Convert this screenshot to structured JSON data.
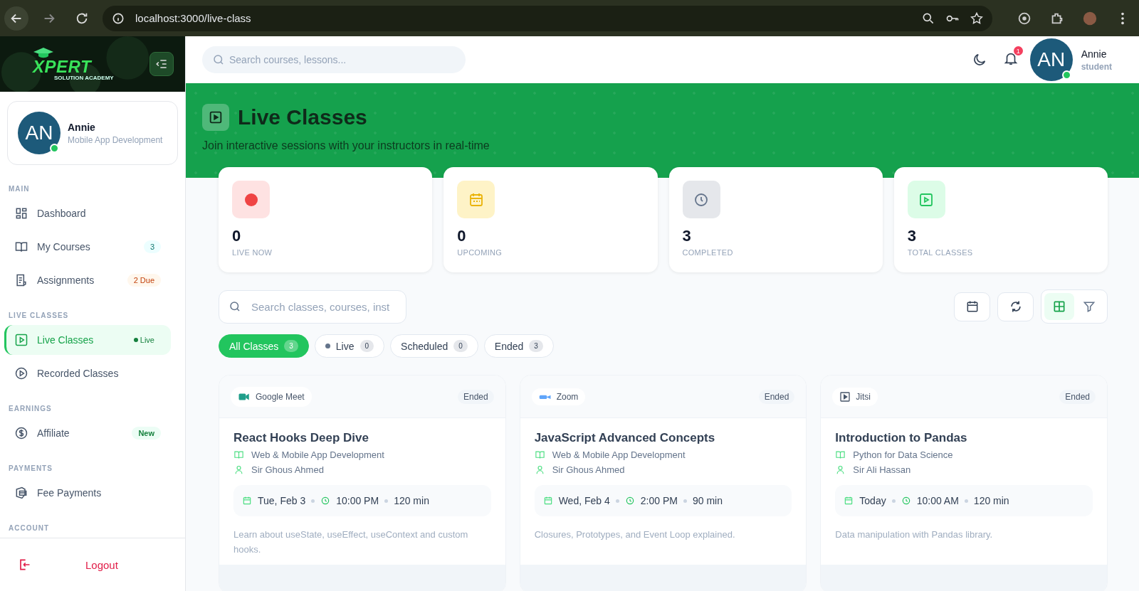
{
  "browser": {
    "url": "localhost:3000/live-class"
  },
  "sidebar": {
    "logo": {
      "title": "XPERT",
      "subtitle": "SOLUTION ACADEMY"
    },
    "profile": {
      "initials": "AN",
      "name": "Annie",
      "program": "Mobile App Development",
      "online": true
    },
    "sections": [
      {
        "title": "MAIN",
        "items": [
          {
            "label": "Dashboard",
            "selected": false
          },
          {
            "label": "My Courses",
            "badge": {
              "label": "3",
              "kind": "count"
            },
            "selected": false
          },
          {
            "label": "Assignments",
            "badge": {
              "label": "2 Due",
              "kind": "due"
            },
            "selected": false
          }
        ]
      },
      {
        "title": "LIVE CLASSES",
        "items": [
          {
            "label": "Live Classes",
            "badge": {
              "label": "Live",
              "kind": "live"
            },
            "selected": true
          },
          {
            "label": "Recorded Classes",
            "selected": false
          }
        ]
      },
      {
        "title": "EARNINGS",
        "items": [
          {
            "label": "Affiliate",
            "badge": {
              "label": "New",
              "kind": "new"
            },
            "selected": false
          }
        ]
      },
      {
        "title": "PAYMENTS",
        "items": [
          {
            "label": "Fee Payments",
            "selected": false
          }
        ]
      },
      {
        "title": "ACCOUNT"
      }
    ],
    "logout": "Logout"
  },
  "header": {
    "search": {
      "placeholder": "Search courses, lessons..."
    },
    "notifications": "1",
    "user": {
      "initials": "AN",
      "name": "Annie",
      "role": "student",
      "online": true
    }
  },
  "banner": {
    "title": "Live Classes",
    "subtitle": "Join interactive sessions with your instructors in real-time"
  },
  "stats": [
    {
      "kind": "live",
      "value": "0",
      "label": "LIVE NOW"
    },
    {
      "kind": "upcoming",
      "value": "0",
      "label": "UPCOMING"
    },
    {
      "kind": "completed",
      "value": "3",
      "label": "COMPLETED"
    },
    {
      "kind": "total",
      "value": "3",
      "label": "TOTAL CLASSES"
    }
  ],
  "search": {
    "placeholder": "Search classes, courses, inst"
  },
  "view_buttons": [
    {
      "kind": "grid",
      "selected": true
    },
    {
      "kind": "filter",
      "selected": false
    }
  ],
  "filters": [
    {
      "label": "All Classes",
      "count": "3",
      "kind": "all",
      "selected": true
    },
    {
      "label": "Live",
      "count": "0",
      "kind": "live",
      "selected": false
    },
    {
      "label": "Scheduled",
      "count": "0",
      "kind": "scheduled",
      "selected": false
    },
    {
      "label": "Ended",
      "count": "3",
      "kind": "ended",
      "selected": false
    }
  ],
  "classes": [
    {
      "platform": "Google Meet",
      "kind": "meet",
      "status": "Ended",
      "title": "React Hooks Deep Dive",
      "course": "Web & Mobile App Development",
      "instructor": "Sir Ghous Ahmed",
      "date": "Tue, Feb 3",
      "time": "10:00 PM",
      "duration": "120 min",
      "description": "Learn about useState, useEffect, useContext and custom hooks."
    },
    {
      "platform": "Zoom",
      "kind": "zoom",
      "status": "Ended",
      "title": "JavaScript Advanced Concepts",
      "course": "Web & Mobile App Development",
      "instructor": "Sir Ghous Ahmed",
      "date": "Wed, Feb 4",
      "time": "2:00 PM",
      "duration": "90 min",
      "description": "Closures, Prototypes, and Event Loop explained."
    },
    {
      "platform": "Jitsi",
      "kind": "jitsi",
      "status": "Ended",
      "title": "Introduction to Pandas",
      "course": "Python for Data Science",
      "instructor": "Sir Ali Hassan",
      "date": "Today",
      "time": "10:00 AM",
      "duration": "120 min",
      "description": "Data manipulation with Pandas library."
    }
  ]
}
